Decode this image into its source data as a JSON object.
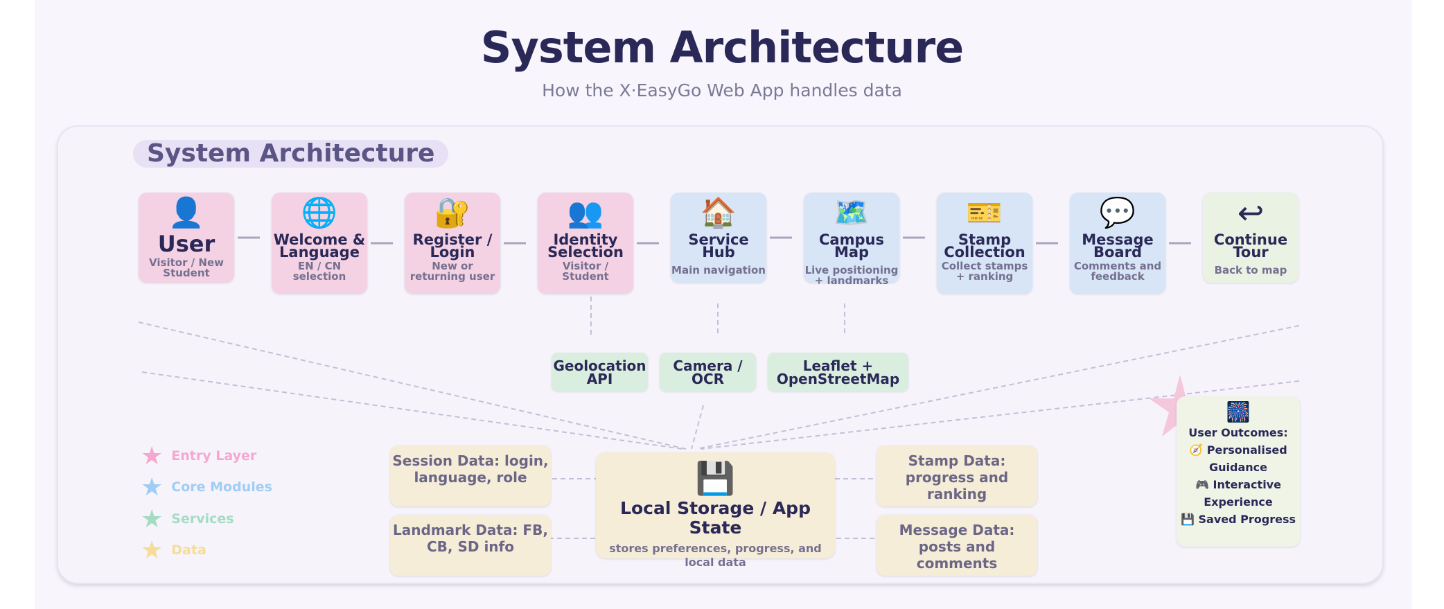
{
  "title": "System Architecture",
  "subtitle": "How the X·EasyGo Web App handles data",
  "panel_title": "System Architecture",
  "flow": [
    {
      "icon": "👤",
      "title": "User",
      "sub": "Visitor / New Student"
    },
    {
      "icon": "🌐",
      "title": "Welcome & Language",
      "sub": "EN / CN selection"
    },
    {
      "icon": "🔐",
      "title": "Register / Login",
      "sub": "New or returning user"
    },
    {
      "icon": "👥",
      "title": "Identity Selection",
      "sub": "Visitor / Student"
    },
    {
      "icon": "🏠",
      "title": "Service Hub",
      "sub": "Main navigation"
    },
    {
      "icon": "🗺️",
      "title": "Campus Map",
      "sub": "Live positioning + landmarks"
    },
    {
      "icon": "🎫",
      "title": "Stamp Collection",
      "sub": "Collect stamps + ranking"
    },
    {
      "icon": "💬",
      "title": "Message Board",
      "sub": "Comments and feedback"
    },
    {
      "icon": "↩",
      "title": "Continue Tour",
      "sub": "Back to map"
    }
  ],
  "services": [
    "Geolocation API",
    "Camera / OCR",
    "Leaflet + OpenStreetMap"
  ],
  "storage": {
    "icon": "💾",
    "title": "Local Storage / App State",
    "sub": "stores preferences, progress, and local data"
  },
  "data_cards": {
    "session": "Session Data: login, language, role",
    "landmark": "Landmark Data: FB, CB, SD info",
    "stamp": "Stamp Data: progress and ranking",
    "message": "Message Data: posts and comments"
  },
  "outcomes": {
    "icon": "🎆",
    "title": "User Outcomes:",
    "items": [
      "🧭 Personalised Guidance",
      "🎮 Interactive Experience",
      "💾 Saved Progress"
    ]
  },
  "legend": [
    {
      "label": "Entry Layer",
      "color": "#f4a8cf"
    },
    {
      "label": "Core Modules",
      "color": "#9fcdf3"
    },
    {
      "label": "Services",
      "color": "#a4dcc3"
    },
    {
      "label": "Data",
      "color": "#f5dc98"
    }
  ],
  "colors": {
    "title": "#2a2857",
    "entry": "#f4d2e4",
    "core": "#d7e5f7",
    "service": "#d9eedf",
    "data": "#f6edd8",
    "outcome": "#eff4e6"
  }
}
